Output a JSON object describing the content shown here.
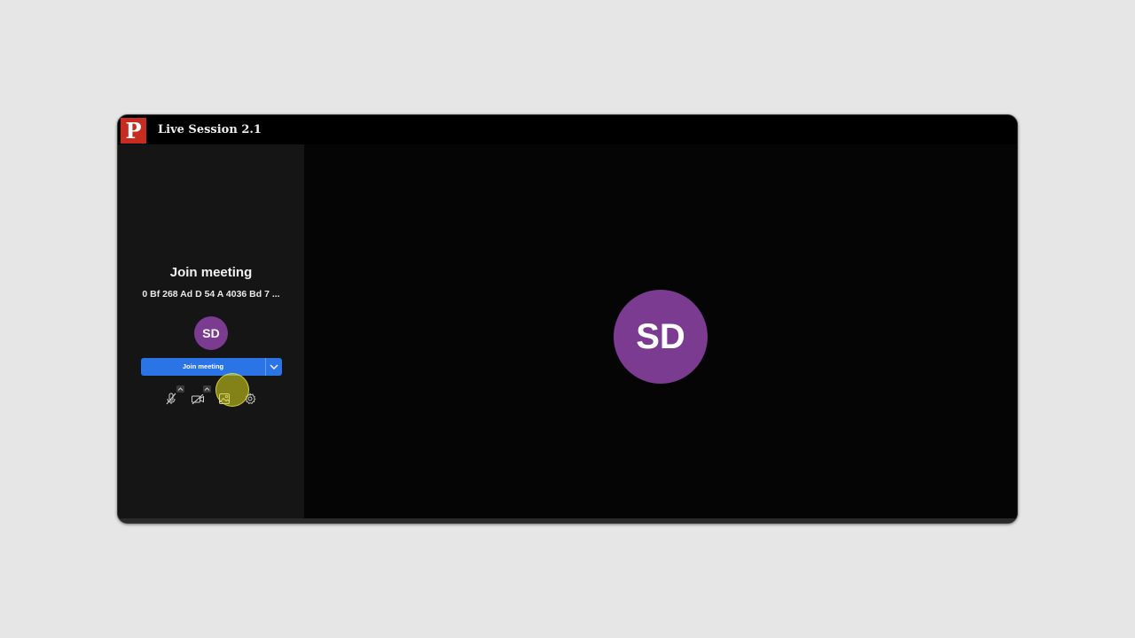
{
  "app": {
    "logo_letter": "P",
    "title": "Live Session 2.1"
  },
  "join_panel": {
    "heading": "Join meeting",
    "meeting_id": "0 Bf 268 Ad D 54 A 4036 Bd 7 ...",
    "avatar_initials": "SD",
    "join_button_label": "Join meeting"
  },
  "controls": [
    {
      "icon": "microphone-off-icon"
    },
    {
      "icon": "camera-off-icon"
    },
    {
      "icon": "background-image-icon"
    },
    {
      "icon": "gear-icon"
    }
  ],
  "stage": {
    "avatar_initials": "SD"
  },
  "colors": {
    "avatar": "#7a3b91",
    "primary_button": "#2a74e6",
    "logo": "#c62d20",
    "sidebar": "#151515",
    "stage": "#050505"
  }
}
